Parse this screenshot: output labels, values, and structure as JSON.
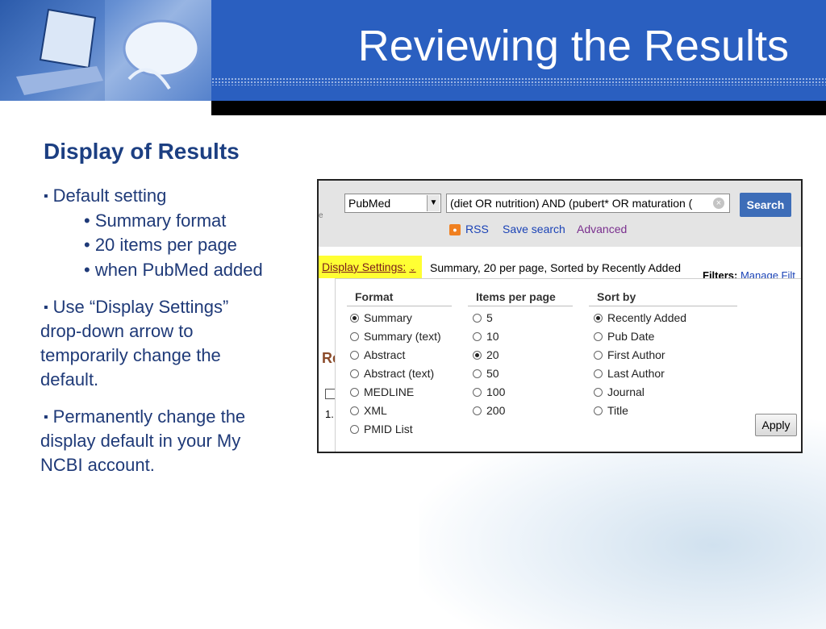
{
  "slide": {
    "title": "Reviewing the Results",
    "subtitle": "Display of Results",
    "bullets": {
      "default_setting": "Default setting",
      "summary_format": "• Summary format",
      "items_per_page": "• 20 items per page",
      "when_added": "• when PubMed added",
      "use_display_line1": "Use “Display Settings”",
      "use_display_line2": "drop-down arrow to",
      "use_display_line3": "temporarily change the",
      "use_display_line4": "default.",
      "permanent_line1": "Permanently change the",
      "permanent_line2": "display default in your My",
      "permanent_line3": "NCBI account."
    }
  },
  "screenshot": {
    "database": "PubMed",
    "query": "(diet OR nutrition) AND (pubert* OR maturation (",
    "search_button": "Search",
    "links": {
      "rss": "RSS",
      "save_search": "Save search",
      "advanced": "Advanced"
    },
    "display_settings_label": "Display Settings:",
    "display_settings_summary": "Summary, 20 per page, Sorted by Recently Added",
    "filters_label": "Filters:",
    "filters_link": "Manage Filt",
    "side": {
      "heading_fragment": "Re",
      "row_number": "1.",
      "edge_fragment": "e"
    },
    "panel": {
      "format_header": "Format",
      "items_header": "Items per page",
      "sort_header": "Sort by",
      "format_options": [
        "Summary",
        "Summary (text)",
        "Abstract",
        "Abstract (text)",
        "MEDLINE",
        "XML",
        "PMID List"
      ],
      "format_selected": "Summary",
      "items_options": [
        "5",
        "10",
        "20",
        "50",
        "100",
        "200"
      ],
      "items_selected": "20",
      "sort_options": [
        "Recently Added",
        "Pub Date",
        "First Author",
        "Last Author",
        "Journal",
        "Title"
      ],
      "sort_selected": "Recently Added",
      "apply_button": "Apply"
    }
  },
  "colors": {
    "header_blue": "#2a5fc0",
    "title_text": "#ffffff",
    "subtitle_text": "#1c3f82",
    "body_text": "#1f3a78",
    "search_button": "#3d6db8",
    "highlight": "#ffff33"
  },
  "icons": [
    "rss-icon",
    "clear-search-icon",
    "dropdown-arrow-icon",
    "bullet-square-icon"
  ]
}
